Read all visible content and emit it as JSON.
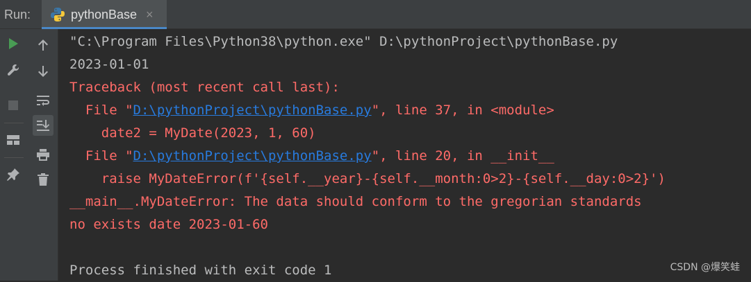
{
  "header": {
    "run_label": "Run:",
    "tab_title": "pythonBase",
    "tab_close": "×"
  },
  "toolbar_left": [
    {
      "icon": "rerun-icon"
    },
    {
      "icon": "wrench-icon"
    },
    {
      "icon": "stop-icon"
    },
    {
      "icon": "layout-icon"
    },
    {
      "icon": "pin-icon"
    }
  ],
  "toolbar_right": [
    {
      "icon": "arrow-up-icon"
    },
    {
      "icon": "arrow-down-icon"
    },
    {
      "icon": "soft-wrap-icon"
    },
    {
      "icon": "scroll-to-end-icon"
    },
    {
      "icon": "print-icon"
    },
    {
      "icon": "trash-icon"
    }
  ],
  "colors": {
    "background": "#2b2b2b",
    "error": "#ff6b68",
    "link": "#287bde",
    "normal": "#bbbcbd",
    "run_green": "#499c54"
  },
  "console": {
    "cmd_line": "\"C:\\Program Files\\Python38\\python.exe\" D:\\pythonProject\\pythonBase.py",
    "date_line": "2023-01-01",
    "traceback_header": "Traceback (most recent call last):",
    "frame1_prefix": "  File \"",
    "frame1_link": "D:\\pythonProject\\pythonBase.py",
    "frame1_suffix": "\", line 37, in <module>",
    "frame1_code": "    date2 = MyDate(2023, 1, 60)",
    "frame2_prefix": "  File \"",
    "frame2_link": "D:\\pythonProject\\pythonBase.py",
    "frame2_suffix": "\", line 20, in __init__",
    "frame2_code": "    raise MyDateError(f'{self.__year}-{self.__month:0>2}-{self.__day:0>2}')",
    "error_line": "__main__.MyDateError: The data should conform to the gregorian standards",
    "error_detail": "no exists date 2023-01-60",
    "exit_line": "Process finished with exit code 1"
  },
  "watermark": "CSDN @爆笑蛙"
}
